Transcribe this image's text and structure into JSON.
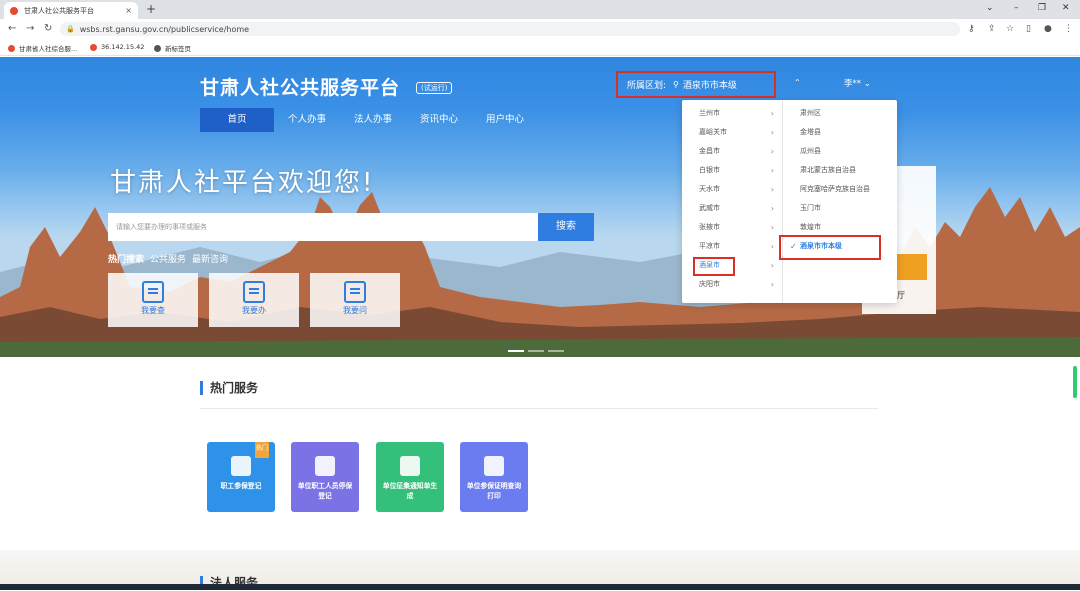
{
  "browser": {
    "tab_title": "甘肃人社公共服务平台",
    "tab_close": "×",
    "new_tab": "+",
    "url": "wsbs.rst.gansu.gov.cn/publicservice/home",
    "bookmarks": [
      "甘肃省人社综合服...",
      "36.142.15.42",
      "新标签页"
    ]
  },
  "header": {
    "logo": "甘肃人社公共服务平台",
    "trial_badge": "(试运行)",
    "nav": [
      "首页",
      "个人办事",
      "法人办事",
      "资讯中心",
      "用户中心"
    ],
    "region_label": "所属区划:",
    "region_value": "酒泉市市本级",
    "user": "李**"
  },
  "hero": {
    "welcome": "甘肃人社平台欢迎您!",
    "search_placeholder": "请输入您要办理的事项或服务",
    "search_button": "搜索",
    "hot_links": [
      "热门搜索",
      "公共服务",
      "最新咨询"
    ],
    "quick": [
      "我要查",
      "我要办",
      "我要问"
    ]
  },
  "dropdown": {
    "cities": [
      "兰州市",
      "嘉峪关市",
      "金昌市",
      "白银市",
      "天水市",
      "武威市",
      "张掖市",
      "平凉市",
      "酒泉市",
      "庆阳市"
    ],
    "selected_city": "酒泉市",
    "districts": [
      "肃州区",
      "金塔县",
      "瓜州县",
      "肃北蒙古族自治县",
      "阿克塞哈萨克族自治县",
      "玉门市",
      "敦煌市",
      "酒泉市市本级"
    ],
    "selected_district": "酒泉市市本级"
  },
  "ghost_text": "厅",
  "hot_services": {
    "title": "热门服务",
    "badge": "热门",
    "cards": [
      {
        "label": "职工参保登记",
        "color": "#2e93e8"
      },
      {
        "label": "单位职工人员停保登记",
        "color": "#7b72e6"
      },
      {
        "label": "单位征集通知单生成",
        "color": "#34c07a"
      },
      {
        "label": "单位参保证明查询打印",
        "color": "#6a7cf0"
      }
    ]
  },
  "section2_title": "法人服务"
}
